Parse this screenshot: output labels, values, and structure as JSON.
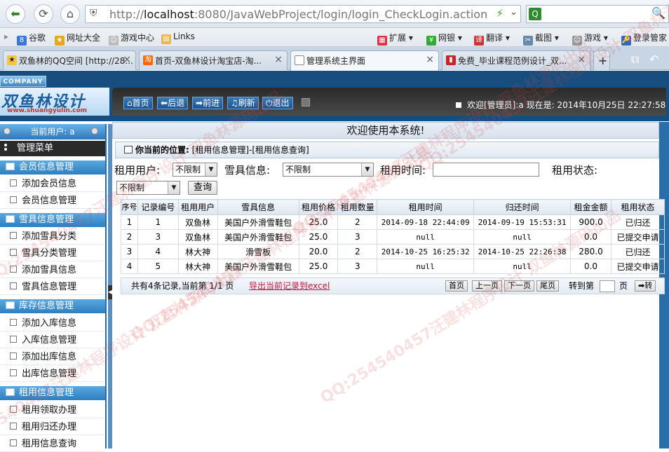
{
  "browser": {
    "url_prefix": "http://",
    "url_host": "localhost",
    "url_rest": ":8080/JavaWebProject/login/login_CheckLogin.action",
    "bookmarks": [
      "谷歌",
      "网址大全",
      "游戏中心",
      "Links",
      "扩展",
      "网银",
      "翻译",
      "截图",
      "游戏",
      "登录管家"
    ],
    "tabs": [
      {
        "label": "双鱼林的QQ空间 [http://28...",
        "active": false
      },
      {
        "label": "首页-双鱼林设计淘宝店-淘...",
        "active": false
      },
      {
        "label": "管理系统主界面",
        "active": true
      },
      {
        "label": "免费_毕业课程范例设计_双...",
        "active": false
      }
    ]
  },
  "header": {
    "company_badge": "COMPANY",
    "logo_text": "双鱼林设计",
    "logo_url": "www.shuangyulin.com",
    "nav": [
      "首页",
      "后退",
      "前进",
      "刷新",
      "退出"
    ],
    "welcome": "欢迎[管理员]:a  现在是: 2014年10月25日 22:27:58"
  },
  "sidebar": {
    "current_user": "当前用户: a",
    "menu_title": "管理菜单",
    "groups": [
      {
        "title": "会员信息管理",
        "items": [
          "添加会员信息",
          "会员信息管理"
        ]
      },
      {
        "title": "雪具信息管理",
        "items": [
          "添加雪具分类",
          "雪具分类管理",
          "添加雪具信息",
          "雪具信息管理"
        ]
      },
      {
        "title": "库存信息管理",
        "items": [
          "添加入库信息",
          "入库信息管理",
          "添加出库信息",
          "出库信息管理"
        ]
      },
      {
        "title": "租用信息管理",
        "items": [
          "租用领取办理",
          "租用归还办理",
          "租用信息查询"
        ]
      }
    ]
  },
  "main": {
    "system_title": "欢迎使用本系统!",
    "location_label": "你当前的位置:",
    "location_path": "[租用信息管理]-[租用信息查询]",
    "filters": {
      "user_label": "租用用户:",
      "user_value": "不限制",
      "gear_label": "雪具信息:",
      "gear_value": "不限制",
      "time_label": "租用时间:",
      "time_value": "",
      "status_label": "租用状态:",
      "status_value": "不限制",
      "query_button": "查询"
    },
    "table": {
      "headers": [
        "序号",
        "记录编号",
        "租用用户",
        "雪具信息",
        "租用价格",
        "租用数量",
        "租用时间",
        "归还时间",
        "租金金额",
        "租用状态"
      ],
      "rows": [
        [
          "1",
          "1",
          "双鱼林",
          "美国户外滑雪鞋包",
          "25.0",
          "2",
          "2014-09-18 22:44:09",
          "2014-09-19 15:53:31",
          "900.0",
          "已归还"
        ],
        [
          "2",
          "3",
          "双鱼林",
          "美国户外滑雪鞋包",
          "25.0",
          "3",
          "null",
          "null",
          "0.0",
          "已提交申请"
        ],
        [
          "3",
          "4",
          "林大神",
          "滑雪板",
          "20.0",
          "2",
          "2014-10-25 16:25:32",
          "2014-10-25 22:26:38",
          "280.0",
          "已归还"
        ],
        [
          "4",
          "5",
          "林大神",
          "美国户外滑雪鞋包",
          "25.0",
          "3",
          "null",
          "null",
          "0.0",
          "已提交申请"
        ]
      ]
    },
    "pager": {
      "summary": "共有4条记录,当前第 1/1 页",
      "export": "导出当前记录到excel",
      "first": "首页",
      "prev": "上一页",
      "next": "下一页",
      "last": "尾页",
      "goto_label": "转到第",
      "page_unit": "页",
      "go_button": "➡转"
    }
  },
  "watermark": "QQ:254540457汪建林程序设计 双鱼林源码出品"
}
